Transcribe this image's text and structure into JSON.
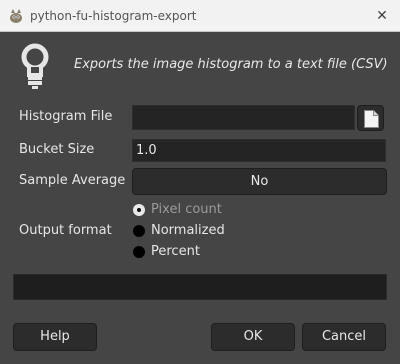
{
  "window": {
    "title": "python-fu-histogram-export",
    "close_glyph": "✕"
  },
  "header": {
    "icon": "lightbulb-icon",
    "description": "Exports the image histogram to a text file (CSV)"
  },
  "form": {
    "histogram_file": {
      "label": "Histogram File",
      "value": ""
    },
    "bucket_size": {
      "label": "Bucket Size",
      "value": "1.0"
    },
    "sample_average": {
      "label": "Sample Average",
      "value": "No"
    },
    "output_format": {
      "label": "Output format",
      "options": [
        "Pixel count",
        "Normalized",
        "Percent"
      ],
      "selected": "Pixel count"
    }
  },
  "progress": {
    "fraction": 0
  },
  "buttons": {
    "help": "Help",
    "ok": "OK",
    "cancel": "Cancel"
  },
  "colors": {
    "background": "#454545",
    "field": "#242424",
    "titlebar": "#f2f2f2"
  }
}
